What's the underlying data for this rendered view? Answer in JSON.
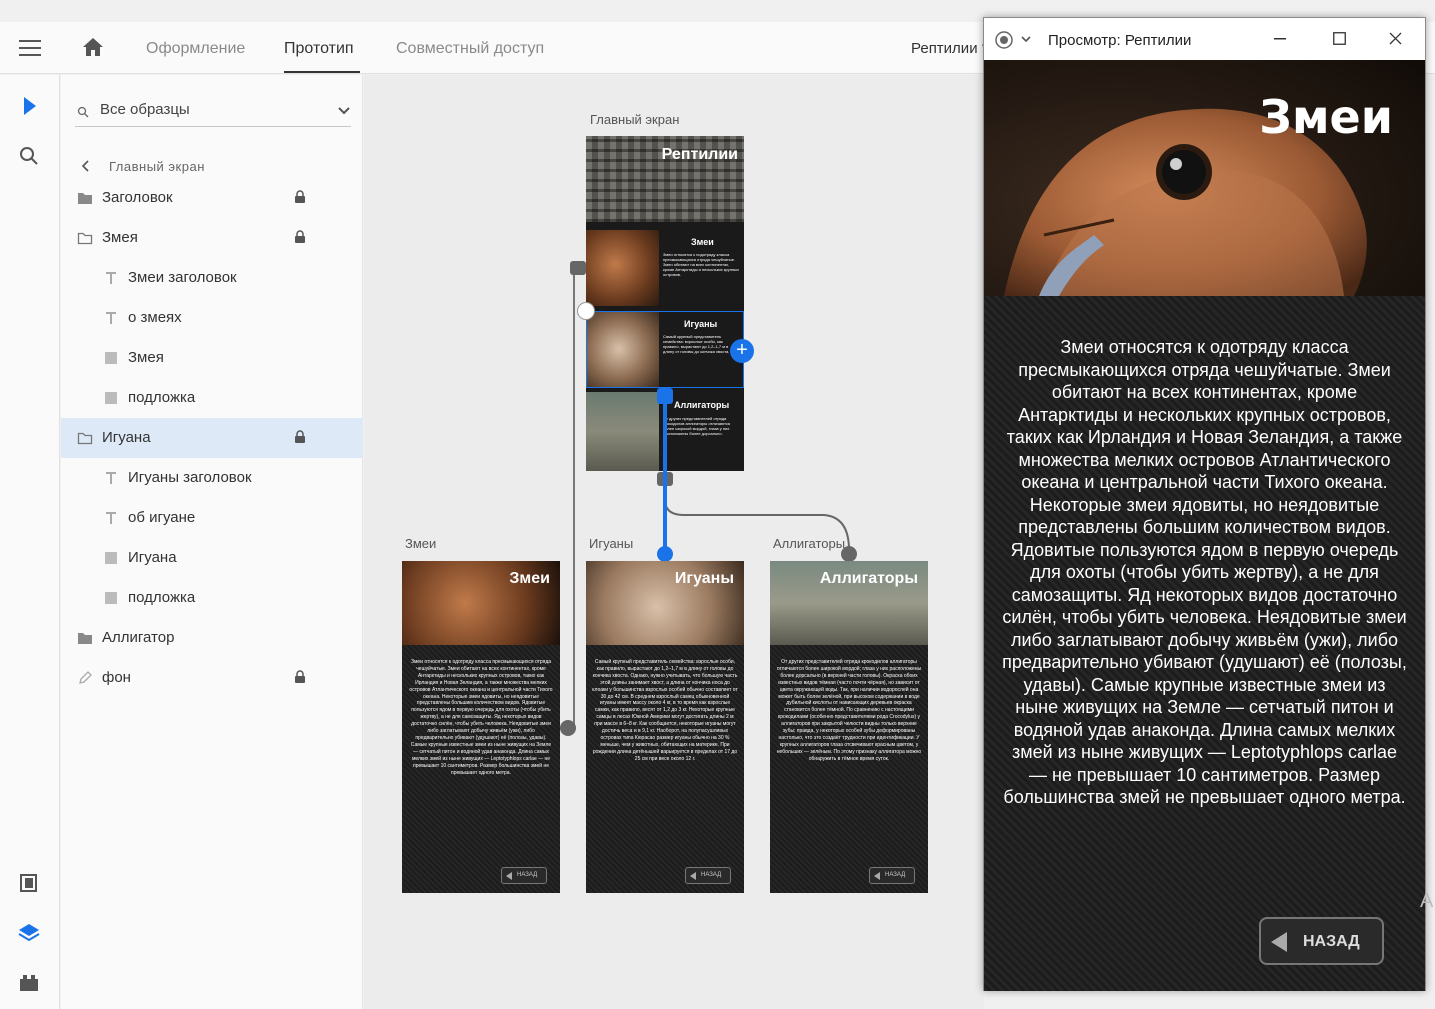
{
  "appbar": {
    "tabs": [
      {
        "label": "Оформление"
      },
      {
        "label": "Прототип"
      },
      {
        "label": "Совместный доступ"
      }
    ],
    "document_title": "Рептилии *"
  },
  "layers_panel": {
    "filter_label": "Все образцы",
    "back_label": "Главный экран",
    "items": [
      {
        "label": "Заголовок",
        "icon": "folder-filled-icon",
        "locked": true
      },
      {
        "label": "Змея",
        "icon": "folder-outline-icon",
        "locked": true
      },
      {
        "label": "Змеи заголовок",
        "icon": "text-icon"
      },
      {
        "label": "о змеях",
        "icon": "text-icon"
      },
      {
        "label": "Змея",
        "icon": "rectangle-icon"
      },
      {
        "label": "подложка",
        "icon": "rectangle-icon"
      },
      {
        "label": "Игуана",
        "icon": "folder-outline-icon",
        "locked": true,
        "selected": true
      },
      {
        "label": "Игуаны заголовок",
        "icon": "text-icon"
      },
      {
        "label": "об игуане",
        "icon": "text-icon"
      },
      {
        "label": "Игуана",
        "icon": "rectangle-icon"
      },
      {
        "label": "подложка",
        "icon": "rectangle-icon"
      },
      {
        "label": "Аллигатор",
        "icon": "folder-filled-icon"
      },
      {
        "label": "фон",
        "icon": "pen-icon",
        "locked": true
      }
    ]
  },
  "canvas": {
    "main_label": "Главный экран",
    "main_board": {
      "title": "Рептилии",
      "sections": [
        {
          "title": "Змеи",
          "text": "Змеи относятся к подотряду класса пресмыкающихся отряда чешуйчатые. Змеи обитают на всех континентах, кроме Антарктиды и нескольких крупных островов."
        },
        {
          "title": "Игуаны",
          "text": "Самый крупный представитель семейства: взрослые особи, как правило, вырастают до 1,2–1,7 м в длину от головы до кончика хвоста."
        },
        {
          "title": "Аллигаторы",
          "text": "От других представителей отряда крокодилов аллигаторы отличаются более широкой мордой, глаза у них расположены более дорсально."
        }
      ]
    },
    "boards": [
      {
        "label": "Змеи",
        "title": "Змеи",
        "back": "НАЗАД",
        "text": "Змеи относятся к одотряду класса пресмыкающихся отряда чешуйчатые. Змеи обитают на всех континентах, кроме Антарктиды и нескольких крупных островов, таких как Ирландия и Новая Зеландия, а также множества мелких островов Атлантического океана и центральной части Тихого океана. Некоторые змеи ядовиты, но неядовитые представлены большим количеством видов. Ядовитые пользуются ядом в первую очередь для охоты (чтобы убить жертву), а не для самозащиты. Яд некоторых видов достаточно силён, чтобы убить человека. Неядовитые змеи либо заглатывают добычу живьём (ужи), либо предварительно убивают (удушают) её (полозы, удавы). Самые крупные известные змеи из ныне живущих на Земле — сетчатый питон и водяной удав анаконда. Длина самых мелких змей из ныне живущих — Leptotyphlops carlae — не превышает 10 сантиметров. Размер большинства змей не превышает одного метра."
      },
      {
        "label": "Игуаны",
        "title": "Игуаны",
        "back": "НАЗАД",
        "text": "Самый крупный представитель семейства: взрослые особи, как правило, вырастают до 1,2–1,7 м в длину от головы до кончика хвоста. Однако, нужно учитывать, что большую часть этой длины занимает хвост, а длина от кончика носа до клоаки у большинства взрослых особей обычно составляет от 30 до 42 см. В среднем взрослый самец обыкновенной игуаны имеет массу около 4 кг, в то время как взрослые самки, как правило, весят от 1,2 до 3 кг. Некоторые крупные самцы в лесах Южной Америки могут достигать длины 2 м при массе в 6–8 кг. Как сообщается, некоторые игуаны могут достичь веса и в 9,1 кг. Наоборот, на полупасушливых островах типа Кюрасао размер игуаны обычно на 30 % меньше, чем у животных, обитающих на материке. При рождении длина детёнышей варьируется в пределах от 17 до 25 см при весе около 12 г."
      },
      {
        "label": "Аллигаторы",
        "title": "Аллигаторы",
        "back": "НАЗАД",
        "text": "От других представителей отряда крокодилов аллигаторы отличаются более широкой мордой; глаза у них расположены более дорсально (в верхней части головы). Окраска обоих известных видов тёмная (часто почти чёрная), но зависит от цвета окружающей воды. Так, при наличии водорослей она может быть более зелёной, при высоком содержании в воде дубильной кислоты от нависающих деревьев окраска становится более тёмной. По сравнению с настоящими крокодилами (особенно представителями рода Crocodylus) у аллигаторов при закрытой челюсти видны только верхние зубы; правда, у некоторых особей зубы деформированы настолько, что это создаёт трудности при идентификации. У крупных аллигаторов глаза отсвечивают красным цветом, у небольших — зелёным. По этому признаку аллигатора можно обнаружить в тёмное время суток."
      }
    ]
  },
  "preview": {
    "window_title": "Просмотр: Рептилии",
    "heading": "Змеи",
    "back_label": "НАЗАД",
    "body_text": "Змеи относятся к одотряду класса пресмыкающихся отряда чешуйчатые. Змеи обитают на всех континентах, кроме Антарктиды и нескольких крупных островов, таких как Ирландия и Новая Зеландия, а также множества мелких островов Атлантического океана и центральной части Тихого океана. Некоторые змеи ядовиты, но неядовитые представлены большим количеством видов. Ядовитые пользуются ядом в первую очередь для охоты (чтобы убить жертву), а не для самозащиты. Яд некоторых видов достаточно силён, чтобы убить человека. Неядовитые змеи либо заглатывают добычу живьём (ужи), либо предварительно убивают (удушают) её (полозы, удавы). Самые крупные известные змеи из ныне живущих на Земле — сетчатый питон и водяной удав анаконда. Длина самых мелких змей из ныне живущих — Leptotyphlops carlae — не превышает 10 сантиметров. Размер большинства змей не превышает одного метра."
  },
  "edge_text": "A",
  "colors": {
    "accent": "#1a73e8",
    "selection": "#dde9f7"
  }
}
